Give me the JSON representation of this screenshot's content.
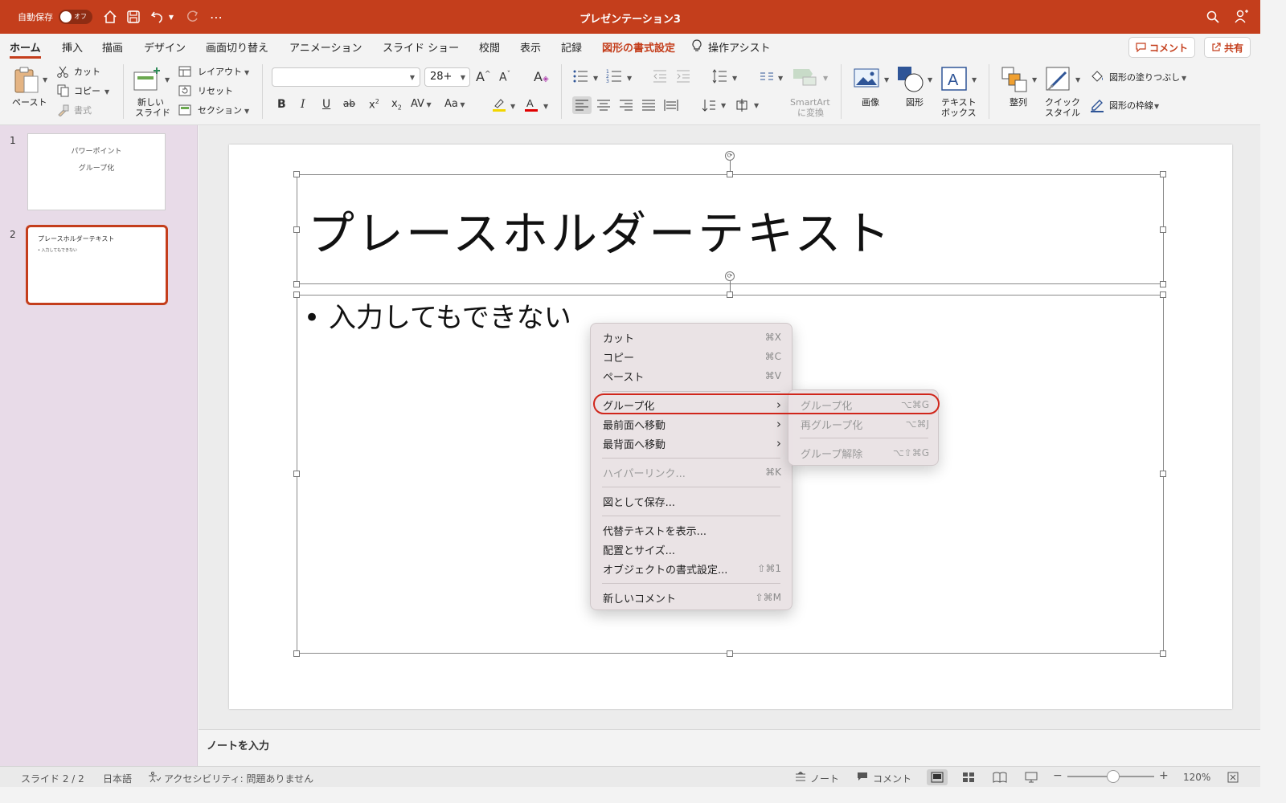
{
  "titlebar": {
    "autosave_label": "自動保存",
    "toggle_label": "オフ",
    "doc_title": "プレゼンテーション3"
  },
  "tabs": {
    "home": "ホーム",
    "insert": "挿入",
    "draw": "描画",
    "design": "デザイン",
    "transitions": "画面切り替え",
    "animations": "アニメーション",
    "slideshow": "スライド ショー",
    "review": "校閲",
    "view": "表示",
    "record": "記録",
    "shape_format": "図形の書式設定",
    "tell_me": "操作アシスト",
    "comment_btn": "コメント",
    "share_btn": "共有"
  },
  "ribbon": {
    "paste": "ペースト",
    "cut": "カット",
    "copy": "コピー",
    "format": "書式",
    "new_slide_1": "新しい",
    "new_slide_2": "スライド",
    "layout": "レイアウト",
    "reset": "リセット",
    "section": "セクション",
    "font_name": "",
    "font_size": "28+",
    "smartart_1": "SmartArt",
    "smartart_2": "に変換",
    "picture": "画像",
    "shapes": "図形",
    "textbox_1": "テキスト",
    "textbox_2": "ボックス",
    "arrange": "整列",
    "quick_styles_1": "クイック",
    "quick_styles_2": "スタイル",
    "shape_fill": "図形の塗りつぶし",
    "shape_outline": "図形の枠線"
  },
  "thumbnails": [
    {
      "num": "1",
      "title": "パワーポイント",
      "subtitle": "グループ化"
    },
    {
      "num": "2",
      "title": "プレースホルダーテキスト",
      "bullet": "• 入力してもできない"
    }
  ],
  "slide": {
    "title": "プレースホルダーテキスト",
    "bullet": "• 入力してもできない"
  },
  "context_menu": {
    "items": [
      {
        "label": "カット",
        "shortcut": "⌘X"
      },
      {
        "label": "コピー",
        "shortcut": "⌘C"
      },
      {
        "label": "ペースト",
        "shortcut": "⌘V"
      },
      {
        "label": "グループ化",
        "shortcut": "›"
      },
      {
        "label": "最前面へ移動",
        "shortcut": "›"
      },
      {
        "label": "最背面へ移動",
        "shortcut": "›"
      },
      {
        "label": "ハイパーリンク...",
        "shortcut": "⌘K"
      },
      {
        "label": "図として保存...",
        "shortcut": ""
      },
      {
        "label": "代替テキストを表示...",
        "shortcut": ""
      },
      {
        "label": "配置とサイズ...",
        "shortcut": ""
      },
      {
        "label": "オブジェクトの書式設定...",
        "shortcut": "⇧⌘1"
      },
      {
        "label": "新しいコメント",
        "shortcut": "⇧⌘M"
      }
    ]
  },
  "submenu": {
    "items": [
      {
        "label": "グループ化",
        "shortcut": "⌥⌘G"
      },
      {
        "label": "再グループ化",
        "shortcut": "⌥⌘J"
      },
      {
        "label": "グループ解除",
        "shortcut": "⌥⇧⌘G"
      }
    ]
  },
  "notes": {
    "placeholder": "ノートを入力"
  },
  "status": {
    "slide_count": "スライド 2 / 2",
    "language": "日本語",
    "accessibility": "アクセシビリティ: 問題ありません",
    "notes": "ノート",
    "comments": "コメント",
    "zoom": "120%",
    "zoom_level_percent": 120
  },
  "colors": {
    "accent": "#c43e1c",
    "thumb_pane": "#e8dbe8",
    "highlight_ring": "#d0261b"
  }
}
